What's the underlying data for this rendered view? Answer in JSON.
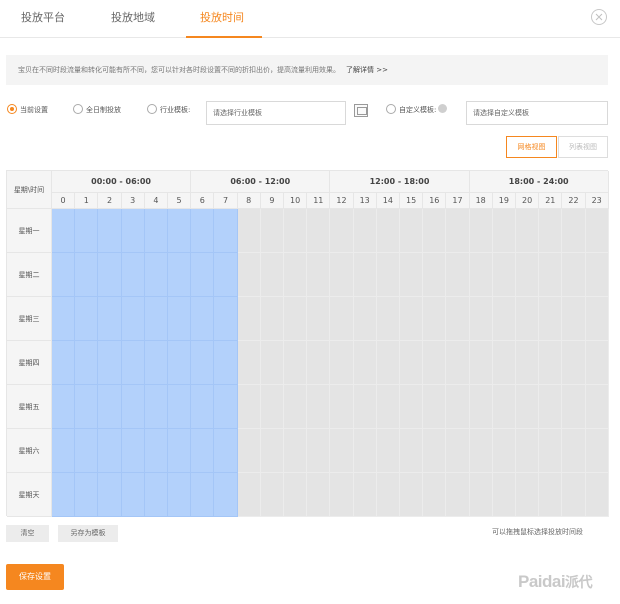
{
  "tabs": [
    {
      "label": "投放平台",
      "active": false
    },
    {
      "label": "投放地域",
      "active": false
    },
    {
      "label": "投放时间",
      "active": true
    }
  ],
  "tip": {
    "text": "宝贝在不同时段流量和转化可能有所不同，您可以针对各时段设置不同的折扣出价，提高流量利用效果。",
    "link": "了解详情 >>"
  },
  "options": {
    "current": "当前设置",
    "allday": "全日制投放",
    "industry": "行业模板:",
    "industry_placeholder": "请选择行业模板",
    "custom": "自定义模板:",
    "custom_placeholder": "请选择自定义模板",
    "selected": "current"
  },
  "view": {
    "grid_label": "网格视图",
    "list_label": "列表视图",
    "active": "grid"
  },
  "schedule": {
    "corner_label": "星期\\时间",
    "groups": [
      "00:00 - 06:00",
      "06:00 - 12:00",
      "12:00 - 18:00",
      "18:00 - 24:00"
    ],
    "hours": [
      "0",
      "1",
      "2",
      "3",
      "4",
      "5",
      "6",
      "7",
      "8",
      "9",
      "10",
      "11",
      "12",
      "13",
      "14",
      "15",
      "16",
      "17",
      "18",
      "19",
      "20",
      "21",
      "22",
      "23"
    ],
    "days": [
      "星期一",
      "星期二",
      "星期三",
      "星期四",
      "星期五",
      "星期六",
      "星期天"
    ],
    "active_hours": [
      0,
      1,
      2,
      3,
      4,
      5,
      6,
      7
    ],
    "active_color": "#b3d1fb",
    "inactive_color": "#e4e4e4"
  },
  "actions": {
    "clear": "清空",
    "save_template": "另存为模板",
    "hint": "可以拖拽鼠标选择投放时间段",
    "save": "保存设置"
  },
  "logo": {
    "latin": "Paidai",
    "cjk": "派代"
  },
  "accent_color": "#f5871f",
  "icons": {
    "close": "close-circle-icon",
    "template": "template-icon",
    "help": "help-icon"
  }
}
